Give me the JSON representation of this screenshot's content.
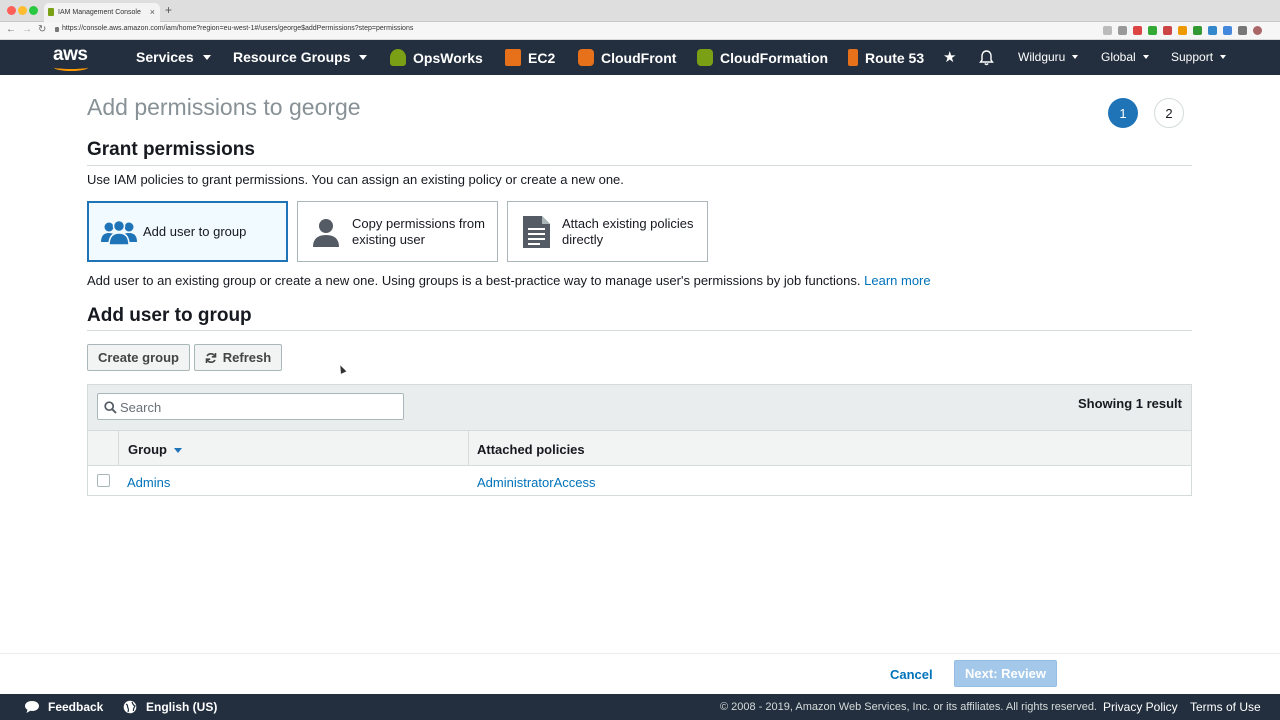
{
  "browser": {
    "tab_title": "IAM Management Console",
    "tab_close": "×",
    "new_tab": "+",
    "url": "https://console.aws.amazon.com/iam/home?region=eu-west-1#/users/george$addPermissions?step=permissions",
    "back_glyph": "←",
    "forward_glyph": "→",
    "reload_glyph": "↻"
  },
  "nav": {
    "logo": "aws",
    "services": "Services",
    "resource_groups": "Resource Groups",
    "shortcuts": [
      {
        "label": "OpsWorks",
        "icon": "opsworks-icon",
        "color": "#7aa116"
      },
      {
        "label": "EC2",
        "icon": "ec2-icon",
        "color": "#e7711b"
      },
      {
        "label": "CloudFront",
        "icon": "cloudfront-icon",
        "color": "#e7711b"
      },
      {
        "label": "CloudFormation",
        "icon": "cloudformation-icon",
        "color": "#7aa116"
      },
      {
        "label": "Route 53",
        "icon": "route53-icon",
        "color": "#e7711b"
      }
    ],
    "account": "Wildguru",
    "region": "Global",
    "support": "Support"
  },
  "page": {
    "title": "Add permissions to george",
    "steps": [
      "1",
      "2"
    ],
    "grant_heading": "Grant permissions",
    "grant_desc": "Use IAM policies to grant permissions. You can assign an existing policy or create a new one.",
    "options": [
      {
        "label": "Add user to group",
        "icon": "users-group-icon"
      },
      {
        "label": "Copy permissions from existing user",
        "icon": "user-icon"
      },
      {
        "label": "Attach existing policies directly",
        "icon": "document-icon"
      }
    ],
    "option_desc": "Add user to an existing group or create a new one. Using groups is a best-practice way to manage user's permissions by job functions.",
    "learn_more": "Learn more",
    "group_heading": "Add user to group",
    "create_group": "Create group",
    "refresh": "Refresh"
  },
  "table": {
    "search_placeholder": "Search",
    "result_count": "Showing 1 result",
    "columns": [
      "Group",
      "Attached policies"
    ],
    "rows": [
      {
        "group": "Admins",
        "policies": "AdministratorAccess"
      }
    ]
  },
  "footer": {
    "cancel": "Cancel",
    "next": "Next: Review"
  },
  "bottombar": {
    "feedback": "Feedback",
    "language": "English (US)",
    "copyright": "© 2008 - 2019, Amazon Web Services, Inc. or its affiliates. All rights reserved.",
    "privacy": "Privacy Policy",
    "terms": "Terms of Use"
  },
  "colors": {
    "nav_bg": "#232f3e",
    "accent": "#1f73b7",
    "link": "#0073bb",
    "brand_orange": "#ff9900"
  }
}
